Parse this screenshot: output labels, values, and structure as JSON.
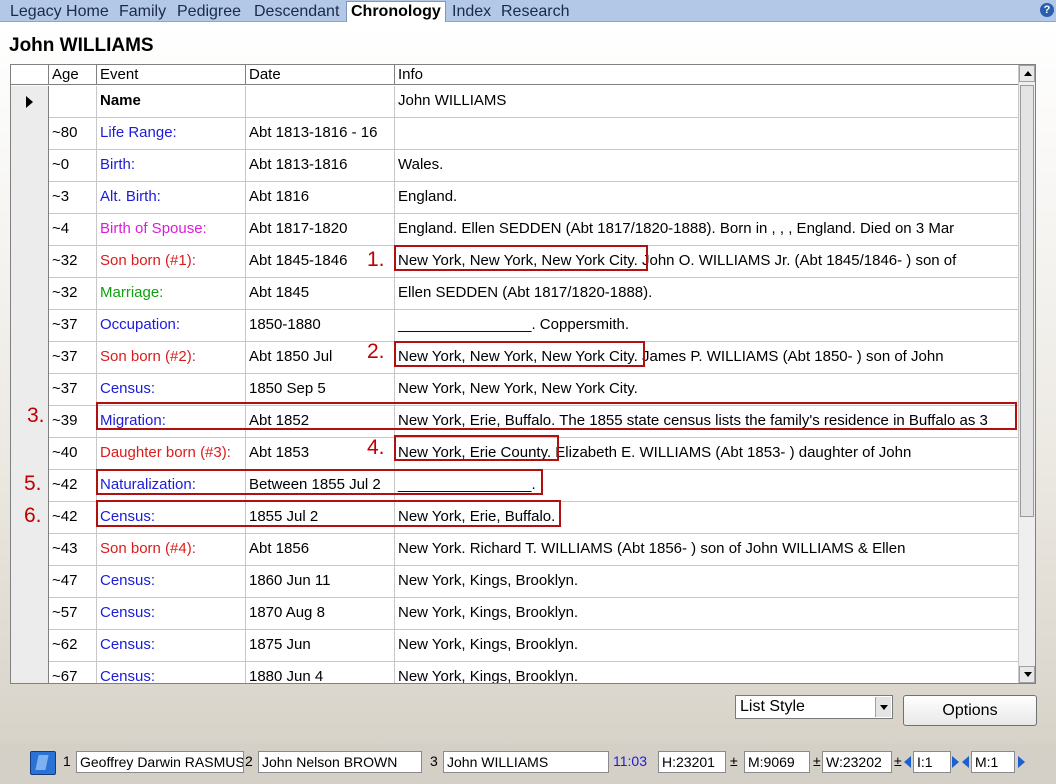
{
  "tabs": [
    {
      "label": "Legacy Home",
      "active": false
    },
    {
      "label": "Family",
      "active": false
    },
    {
      "label": "Pedigree",
      "active": false
    },
    {
      "label": "Descendant",
      "active": false
    },
    {
      "label": "Chronology",
      "active": true
    },
    {
      "label": "Index",
      "active": false
    },
    {
      "label": "Research",
      "active": false
    }
  ],
  "help_glyph": "?",
  "person_title": "John WILLIAMS",
  "columns": {
    "age": "Age",
    "event": "Event",
    "date": "Date",
    "info": "Info"
  },
  "event_colors": {
    "black": "#000000",
    "blue": "#1c1cd8",
    "red": "#dc1c1c",
    "magenta": "#dc1cdc",
    "green": "#10a010"
  },
  "rows": [
    {
      "age": "",
      "event": "Name",
      "date": "",
      "info": "John WILLIAMS",
      "color": "black",
      "bold": true,
      "current": true
    },
    {
      "age": "~80",
      "event": "Life Range:",
      "date": "Abt 1813-1816 - 16",
      "info": "",
      "color": "blue"
    },
    {
      "age": "~0",
      "event": "Birth:",
      "date": "Abt 1813-1816",
      "info": "Wales.",
      "color": "blue"
    },
    {
      "age": "~3",
      "event": "Alt. Birth:",
      "date": "Abt 1816",
      "info": "England.",
      "color": "blue"
    },
    {
      "age": "~4",
      "event": "Birth of Spouse:",
      "date": "Abt 1817-1820",
      "info": "England.  Ellen SEDDEN (Abt 1817/1820-1888).  Born in , , , England.  Died on 3 Mar",
      "color": "magenta"
    },
    {
      "age": "~32",
      "event": "Son born (#1):",
      "date": "Abt 1845-1846",
      "info": "New York, New York, New York City.  John O. WILLIAMS Jr. (Abt 1845/1846-          ) son of",
      "color": "red"
    },
    {
      "age": "~32",
      "event": "Marriage:",
      "date": "Abt 1845",
      "info": "Ellen SEDDEN (Abt 1817/1820-1888).",
      "color": "green"
    },
    {
      "age": "~37",
      "event": "Occupation:",
      "date": "1850-1880",
      "info": "________________.   Coppersmith.",
      "color": "blue"
    },
    {
      "age": "~37",
      "event": "Son born (#2):",
      "date": "Abt 1850 Jul",
      "info": "New York, New York, New York City.  James P. WILLIAMS (Abt 1850-          ) son of John",
      "color": "red"
    },
    {
      "age": "~37",
      "event": "Census:",
      "date": "1850 Sep 5",
      "info": "New York, New York, New York City.",
      "color": "blue"
    },
    {
      "age": "~39",
      "event": "Migration:",
      "date": "Abt 1852",
      "info": "New York, Erie, Buffalo.   The 1855 state census lists the family's residence in Buffalo as 3",
      "color": "blue"
    },
    {
      "age": "~40",
      "event": "Daughter born (#3):",
      "date": "Abt 1853",
      "info": "New York, Erie County.  Elizabeth E. WILLIAMS (Abt 1853-          ) daughter of John",
      "color": "red"
    },
    {
      "age": "~42",
      "event": "Naturalization:",
      "date": "Between 1855 Jul 2",
      "info": "________________.",
      "color": "blue"
    },
    {
      "age": "~42",
      "event": "Census:",
      "date": "1855 Jul 2",
      "info": "New York, Erie, Buffalo.",
      "color": "blue"
    },
    {
      "age": "~43",
      "event": "Son born (#4):",
      "date": "Abt 1856",
      "info": "New York.  Richard T. WILLIAMS (Abt 1856-          ) son of John WILLIAMS & Ellen",
      "color": "red"
    },
    {
      "age": "~47",
      "event": "Census:",
      "date": "1860 Jun 11",
      "info": "New York, Kings, Brooklyn.",
      "color": "blue"
    },
    {
      "age": "~57",
      "event": "Census:",
      "date": "1870 Aug 8",
      "info": "New York, Kings, Brooklyn.",
      "color": "blue"
    },
    {
      "age": "~62",
      "event": "Census:",
      "date": "1875 Jun",
      "info": "New York, Kings, Brooklyn.",
      "color": "blue"
    },
    {
      "age": "~67",
      "event": "Census:",
      "date": "1880 Jun 4",
      "info": "New York, Kings, Brooklyn.",
      "color": "blue"
    }
  ],
  "annotations": [
    "1.",
    "2.",
    "3.",
    "4.",
    "5.",
    "6."
  ],
  "controls": {
    "list_style": "List Style",
    "options": "Options"
  },
  "status": {
    "slot1_num": "1",
    "slot1_name": "Geoffrey Darwin RASMUS",
    "slot2_num": "2",
    "slot2_name": "John Nelson BROWN",
    "slot3_num": "3",
    "slot3_name": "John WILLIAMS",
    "time": "11:03",
    "h": "H:23201",
    "m": "M:9069",
    "w": "W:23202",
    "pm1": "±",
    "pm2": "±",
    "pm3": "±",
    "i": "I:1",
    "mm": "M:1"
  },
  "annotation_color": "#b01010"
}
